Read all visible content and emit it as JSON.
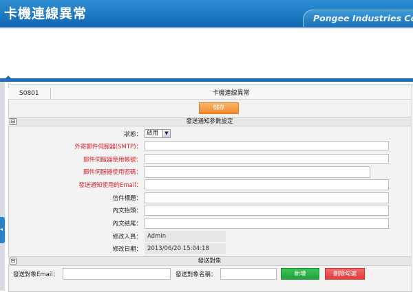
{
  "banner": {
    "title": "卡機連線異常",
    "company": "Pongee Industries Co"
  },
  "header": {
    "code": "S0801",
    "name": "卡機連線異常"
  },
  "toolbar": {
    "save_label": "儲存"
  },
  "section1": {
    "title": "發送通知參數設定",
    "toggle": "⊟"
  },
  "fields": {
    "status": {
      "label": "狀態：",
      "value": "啟用"
    },
    "smtp": {
      "label": "外寄郵件伺服器(SMTP)：",
      "value": ""
    },
    "account": {
      "label": "郵件伺服器使用帳號：",
      "value": ""
    },
    "password": {
      "label": "郵件伺服器使用密碼：",
      "value": ""
    },
    "email": {
      "label": "發送通知使用的Email：",
      "value": ""
    },
    "subject": {
      "label": "信件標題：",
      "value": ""
    },
    "intro": {
      "label": "內文抬頭：",
      "value": ""
    },
    "ending": {
      "label": "內文結尾：",
      "value": ""
    },
    "modifier": {
      "label": "修改人員：",
      "value": "Admin"
    },
    "modified_date": {
      "label": "修改日期：",
      "value": "2013/06/20 15:04:18"
    }
  },
  "section2": {
    "title": "發送對象",
    "toggle": "⊟"
  },
  "recipient": {
    "email_label": "發送對象Email：",
    "email_value": "",
    "name_label": "發送對象名稱：",
    "name_value": "",
    "add_label": "新增",
    "delete_label": "刪除勾選"
  },
  "colors": {
    "banner": "#1a6fb7",
    "save": "#f39c42",
    "add": "#2bb24a",
    "delete": "#e84c4c",
    "required_label": "#d9232a"
  }
}
